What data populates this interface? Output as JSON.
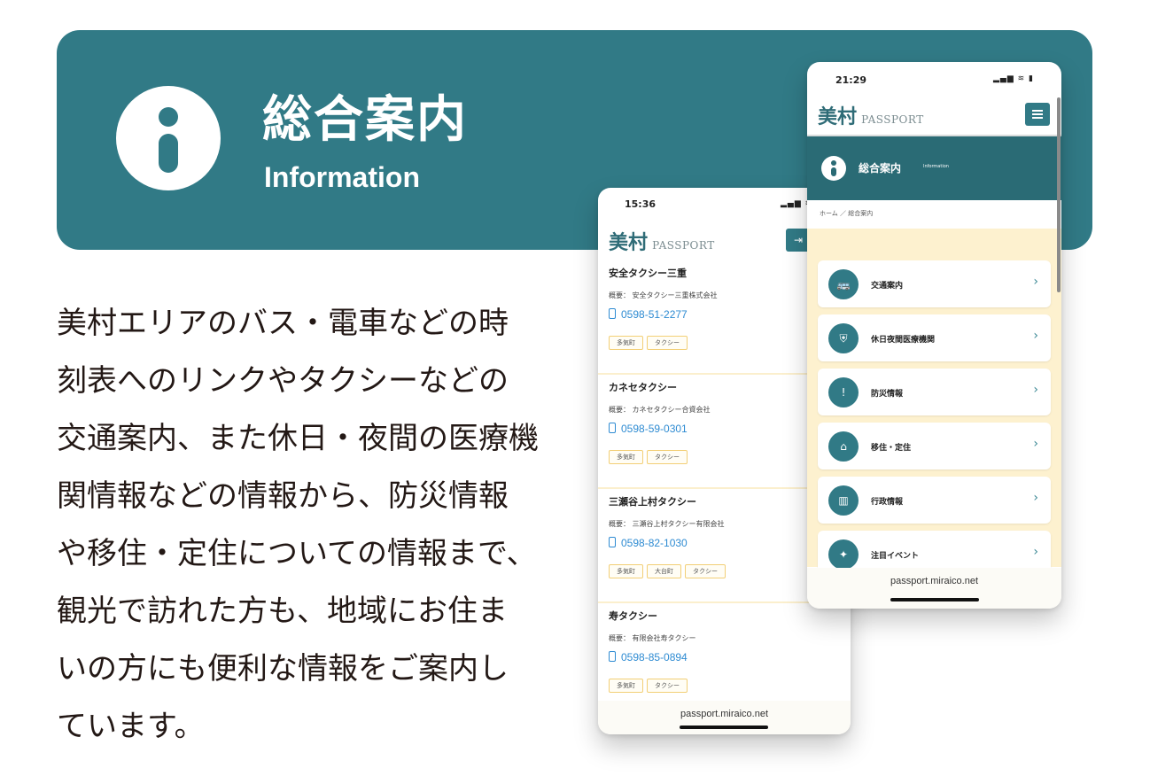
{
  "header": {
    "title": "総合案内",
    "subtitle": "Information",
    "icon": "info-icon"
  },
  "description": {
    "lines": [
      "美村エリアのバス・電車などの時",
      "刻表へのリンクやタクシーなどの",
      "交通案内、また休日・夜間の医療機",
      "関情報などの情報から、防災情報",
      "や移住・定住についての情報まで、",
      "観光で訪れた方も、地域にお住ま",
      "いの方にも便利な情報をご案内し",
      "ています。"
    ]
  },
  "phone1": {
    "time": "15:36",
    "status": "▂▄▆ ≋",
    "logo_kanji": "美村",
    "logo_text": "PASSPORT",
    "login_icon": "login-icon",
    "taxis": [
      {
        "name": "安全タクシー三重",
        "company": "概要： 安全タクシー三重株式会社",
        "phone": "0598-51-2277",
        "tags": [
          "多気町",
          "タクシー"
        ]
      },
      {
        "name": "カネセタクシー",
        "company": "概要： カネセタクシー合資会社",
        "phone": "0598-59-0301",
        "tags": [
          "多気町",
          "タクシー"
        ]
      },
      {
        "name": "三瀬谷上村タクシー",
        "company": "概要： 三瀬谷上村タクシー有限会社",
        "phone": "0598-82-1030",
        "tags": [
          "多気町",
          "大台町",
          "タクシー"
        ]
      },
      {
        "name": "寿タクシー",
        "company": "概要： 有限会社寿タクシー",
        "phone": "0598-85-0894",
        "tags": [
          "多気町",
          "タクシー"
        ]
      }
    ],
    "url": "passport.miraico.net"
  },
  "phone2": {
    "time": "21:29",
    "status": "▂▄▆ ≋ ▮",
    "logo_kanji": "美村",
    "logo_text": "PASSPORT",
    "menu_icon": "hamburger-icon",
    "banner_title": "総合案内",
    "banner_subtitle": "Information",
    "breadcrumb": "ホーム ／ 総合案内",
    "menu": [
      {
        "label": "交通案内",
        "icon": "bus-icon",
        "glyph": "🚌"
      },
      {
        "label": "休日夜間医療機関",
        "icon": "shield-icon",
        "glyph": "⛨"
      },
      {
        "label": "防災情報",
        "icon": "alert-icon",
        "glyph": "!"
      },
      {
        "label": "移住・定住",
        "icon": "house-icon",
        "glyph": "⌂"
      },
      {
        "label": "行政情報",
        "icon": "building-icon",
        "glyph": "▥"
      },
      {
        "label": "注目イベント",
        "icon": "party-icon",
        "glyph": "✦"
      }
    ],
    "url": "passport.miraico.net"
  },
  "colors": {
    "teal": "#317a86",
    "cream": "#fdf1cf",
    "link_blue": "#2e8bd2",
    "tag_border": "#f2cf76"
  }
}
